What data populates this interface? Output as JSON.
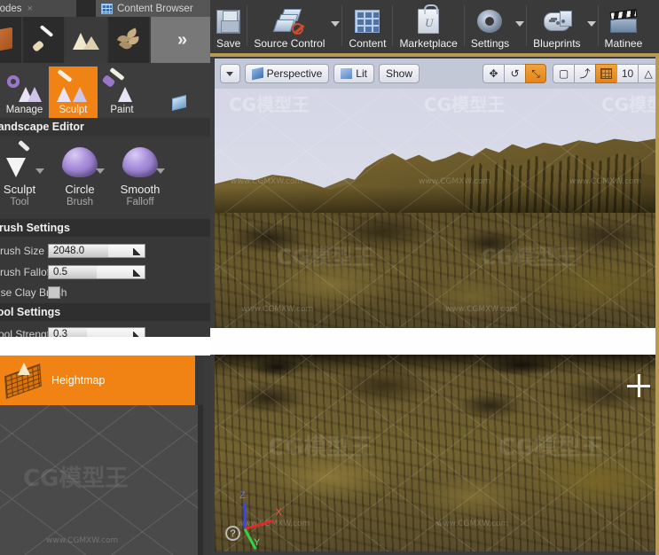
{
  "tabs": [
    {
      "label": "Modes",
      "icon": "none",
      "close": "×"
    },
    {
      "label": "Content Browser",
      "icon": "content-browser-icon",
      "close": "×"
    }
  ],
  "mode_bar": {
    "modes": [
      {
        "name": "place-mode",
        "icon": "box-icon"
      },
      {
        "name": "paint-mode",
        "icon": "paintbrush-icon"
      },
      {
        "name": "landscape-mode",
        "icon": "mountain-icon",
        "selected": true
      },
      {
        "name": "foliage-mode",
        "icon": "leaf-icon"
      }
    ],
    "expand_label": "»"
  },
  "landscape_tools": {
    "items": [
      {
        "label": "Manage",
        "icon": "manage-icon",
        "selected": false
      },
      {
        "label": "Sculpt",
        "icon": "sculpt-icon",
        "selected": true
      },
      {
        "label": "Paint",
        "icon": "paint-icon",
        "selected": false
      }
    ],
    "extra_icon": "cube-icon"
  },
  "panel": {
    "title": "Landscape Editor",
    "selectors": [
      {
        "name1": "Sculpt",
        "name2": "Tool",
        "icon": "trowel-icon"
      },
      {
        "name1": "Circle",
        "name2": "Brush",
        "icon": "dome-icon"
      },
      {
        "name1": "Smooth",
        "name2": "Falloff",
        "icon": "dome-icon"
      }
    ],
    "brush_settings": {
      "title": "Brush Settings",
      "rows": [
        {
          "label": "Brush Size",
          "value": "2048.0",
          "type": "spinner",
          "fill_pct": 62
        },
        {
          "label": "Brush Falloff",
          "value": "0.5",
          "type": "spinner",
          "fill_pct": 50
        },
        {
          "label": "Use Clay Brush",
          "value": "",
          "type": "checkbox",
          "checked": false
        }
      ]
    },
    "tool_settings": {
      "title": "Tool Settings",
      "rows": [
        {
          "label": "Tool Strength",
          "value": "0.3",
          "type": "spinner",
          "fill_pct": 40
        }
      ]
    },
    "heightmap": {
      "label": "Heightmap",
      "icon": "heightmap-icon",
      "selected": true
    }
  },
  "toolbar": {
    "items": [
      {
        "label": "Save",
        "icon": "save-disk-icon",
        "dropdown": false
      },
      {
        "label": "Source Control",
        "icon": "source-control-icon",
        "dropdown": true
      },
      {
        "label": "Content",
        "icon": "content-icon",
        "dropdown": false
      },
      {
        "label": "Marketplace",
        "icon": "marketplace-bag-icon",
        "dropdown": false
      },
      {
        "label": "Settings",
        "icon": "settings-gear-icon",
        "dropdown": true
      },
      {
        "label": "Blueprints",
        "icon": "blueprints-icon",
        "dropdown": true
      },
      {
        "label": "Matinee",
        "icon": "matinee-clapper-icon",
        "dropdown": false
      }
    ]
  },
  "viewport_toolbar": {
    "menu_caret": "▼",
    "view_mode": {
      "label": "Perspective",
      "icon": "perspective-cube-icon"
    },
    "lighting": {
      "label": "Lit",
      "icon": "lit-cube-icon"
    },
    "show": {
      "label": "Show"
    },
    "transform_tools": [
      {
        "name": "translate-tool",
        "glyph": "✥",
        "active": false
      },
      {
        "name": "rotate-tool",
        "glyph": "↺",
        "active": false
      },
      {
        "name": "scale-tool",
        "glyph": "⤡",
        "active": true
      }
    ],
    "coordinate_system": {
      "name": "world-coordinate-toggle",
      "glyph": "▢"
    },
    "surface_snap": {
      "name": "surface-snap-toggle",
      "glyph": "⤴"
    },
    "grid_snap": {
      "name": "grid-snap-toggle",
      "glyph": "grid-icon",
      "active": true
    },
    "grid_size_value": "10",
    "rotation_snap": {
      "name": "rotation-snap-toggle",
      "glyph": "△"
    }
  },
  "viewports": {
    "top": {
      "name": "perspective-viewport",
      "sky_color": "#d7d8e7",
      "terrain_color": "#6e5c2c"
    },
    "bottom": {
      "name": "top-down-viewport",
      "terrain_color": "#6f5f2e"
    },
    "gizmo": {
      "z": "Z",
      "x": "X",
      "y": "Y",
      "help": "?"
    }
  },
  "watermarks": {
    "brand": "CG模型王",
    "url": "www.CGMXW.com"
  },
  "colors": {
    "accent_orange": "#f08313",
    "panel_bg": "#3a3a3a",
    "toolbar_bg": "#3a3a3a",
    "viewport_chrome": "#c3c8d6",
    "frame_gold": "#b99a4e"
  }
}
